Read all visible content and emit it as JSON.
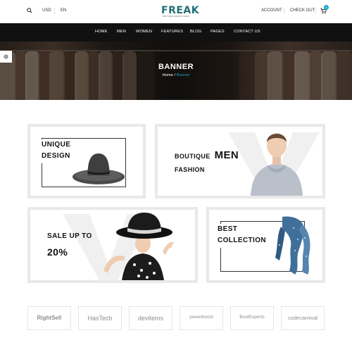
{
  "topbar": {
    "currency": "USD",
    "language": "EN",
    "account": "ACCOUNT",
    "checkout": "CHECK OUT",
    "cart_count": "2",
    "icons": [
      "search-icon",
      "cart-icon"
    ]
  },
  "logo": {
    "word": "FREAK",
    "tagline": "BOUTIQUE FASHION SHOP",
    "color": "#1f6f75"
  },
  "nav": {
    "items": [
      "HOME",
      "MEN",
      "WOMEN",
      "FEATURES",
      "BLOG",
      "PAGES",
      "CONTACT US"
    ]
  },
  "hero": {
    "title": "BANNER",
    "breadcrumb_home": "Home",
    "breadcrumb_sep": " / ",
    "breadcrumb_current": "Banner",
    "accent": "#13a6c8"
  },
  "promos": {
    "unique": {
      "line1": "UNIQUE",
      "line2": "DESIGN"
    },
    "men": {
      "pre": "BOUTIQUE",
      "big": "MEN",
      "post": "FASHION"
    },
    "sale": {
      "line1": "SALE UP TO",
      "line2": "20%"
    },
    "best": {
      "line1": "BEST",
      "line2": "COLLECTION"
    }
  },
  "brands": [
    {
      "name": "RightSell"
    },
    {
      "name": "HasTech"
    },
    {
      "name": "devitems"
    },
    {
      "name": "powerboost"
    },
    {
      "name": "BootExperts"
    },
    {
      "name": "codecarnival"
    }
  ]
}
